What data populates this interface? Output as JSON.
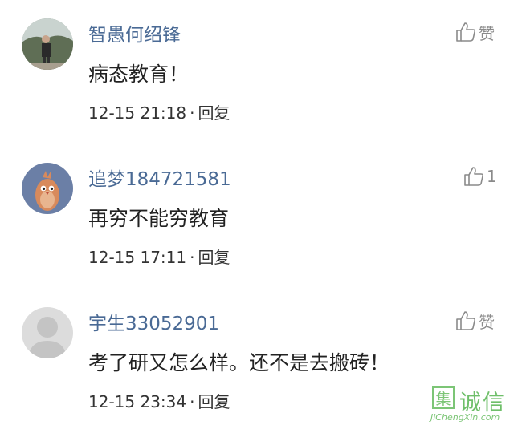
{
  "comments": [
    {
      "avatar": "photo-avatar",
      "username": "智愚何绍锋",
      "content": "病态教育！",
      "time": "12-15 21:18",
      "separator": "·",
      "reply": "回复",
      "like_label": "赞"
    },
    {
      "avatar": "bird-avatar",
      "username": "追梦184721581",
      "content": "再穷不能穷教育",
      "time": "12-15 17:11",
      "separator": "·",
      "reply": "回复",
      "like_label": "1"
    },
    {
      "avatar": "default-avatar",
      "username": "宇生33052901",
      "content": "考了研又怎么样。还不是去搬砖！",
      "time": "12-15 23:34",
      "separator": "·",
      "reply": "回复",
      "like_label": "赞"
    }
  ],
  "watermark": {
    "box_char": "集",
    "chars": "诚信",
    "url": "JiChengXin.com"
  },
  "colors": {
    "username": "#4a6a95",
    "text": "#222222",
    "icon": "#8a8a8a",
    "watermark": "#7cc576"
  }
}
